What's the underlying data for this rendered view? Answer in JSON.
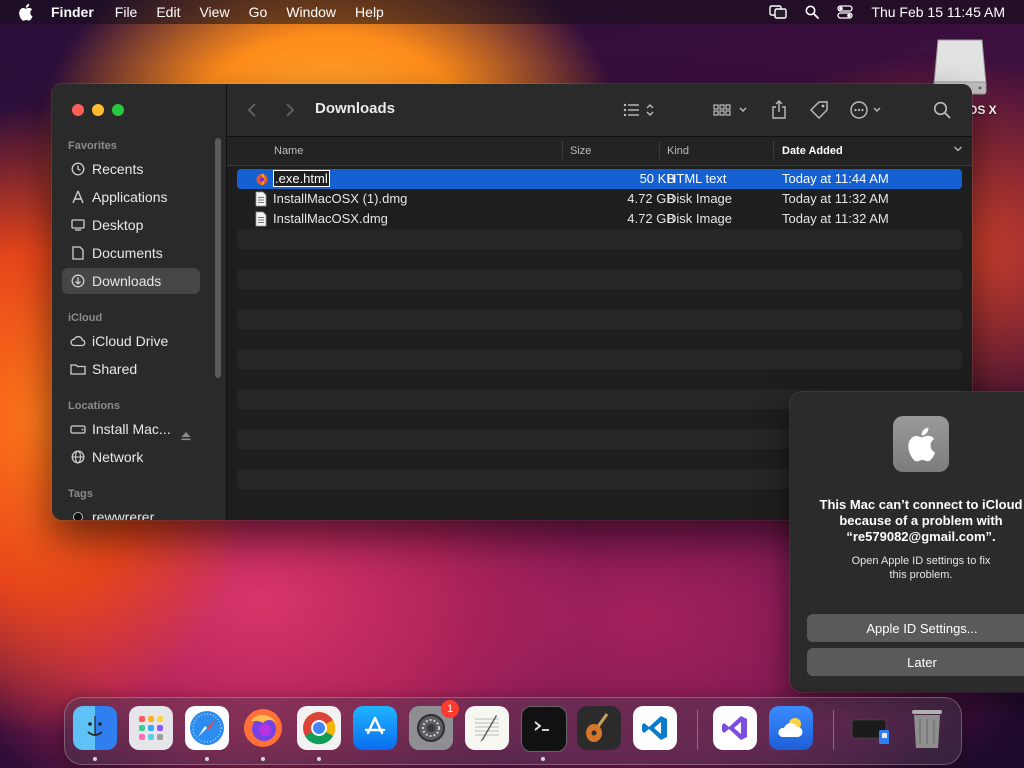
{
  "menubar": {
    "app_name": "Finder",
    "menus": [
      "File",
      "Edit",
      "View",
      "Go",
      "Window",
      "Help"
    ],
    "clock": "Thu Feb 15  11:45 AM"
  },
  "desktop": {
    "drive_label": "OS X"
  },
  "finder": {
    "title": "Downloads",
    "sidebar": {
      "favorites_label": "Favorites",
      "favorites": [
        {
          "label": "Recents",
          "icon": "clock-icon"
        },
        {
          "label": "Applications",
          "icon": "applications-icon"
        },
        {
          "label": "Desktop",
          "icon": "desktop-icon"
        },
        {
          "label": "Documents",
          "icon": "document-icon"
        },
        {
          "label": "Downloads",
          "icon": "download-icon",
          "selected": true
        }
      ],
      "icloud_label": "iCloud",
      "icloud": [
        {
          "label": "iCloud Drive",
          "icon": "cloud-icon"
        },
        {
          "label": "Shared",
          "icon": "shared-folder-icon"
        }
      ],
      "locations_label": "Locations",
      "locations": [
        {
          "label": "Install Mac...",
          "icon": "drive-icon"
        },
        {
          "label": "Network",
          "icon": "globe-icon"
        }
      ],
      "tags_label": "Tags",
      "tags": [
        {
          "label": "rewwrerer"
        }
      ]
    },
    "columns": {
      "name": "Name",
      "size": "Size",
      "kind": "Kind",
      "date_added": "Date Added"
    },
    "files": [
      {
        "name": ".exe.html",
        "size": "50 KB",
        "kind": "HTML text",
        "date": "Today at 11:44 AM",
        "selected": true
      },
      {
        "name": "InstallMacOSX (1).dmg",
        "size": "4.72 GB",
        "kind": "Disk Image",
        "date": "Today at 11:32 AM"
      },
      {
        "name": "InstallMacOSX.dmg",
        "size": "4.72 GB",
        "kind": "Disk Image",
        "date": "Today at 11:32 AM"
      }
    ]
  },
  "notification": {
    "title_line1": "This Mac can’t connect to iCloud",
    "title_line2": "because of a problem with",
    "title_line3": "“re579082@gmail.com”.",
    "body_line1": "Open Apple ID settings to fix",
    "body_line2": "this problem.",
    "primary_button": "Apple ID Settings...",
    "secondary_button": "Later"
  },
  "dock": {
    "apps": [
      {
        "name": "Finder",
        "running": true
      },
      {
        "name": "Launchpad",
        "running": false
      },
      {
        "name": "Safari",
        "running": true
      },
      {
        "name": "Firefox",
        "running": true
      },
      {
        "name": "Chrome",
        "running": true
      },
      {
        "name": "App Store",
        "running": false
      },
      {
        "name": "System Settings",
        "running": false,
        "badge": "1"
      },
      {
        "name": "TextEdit",
        "running": false
      },
      {
        "name": "Terminal",
        "running": true
      },
      {
        "name": "GarageBand",
        "running": false
      },
      {
        "name": "Visual Studio Code",
        "running": false
      },
      {
        "name": "Visual Studio",
        "running": false
      },
      {
        "name": "Weather",
        "running": false
      },
      {
        "name": "Downloads Stack",
        "running": false
      },
      {
        "name": "Trash",
        "running": false
      }
    ]
  },
  "colors": {
    "selection_blue": "#1560d0",
    "window_bg": "#1e1e1e",
    "sidebar_bg": "#2a2a2a"
  }
}
